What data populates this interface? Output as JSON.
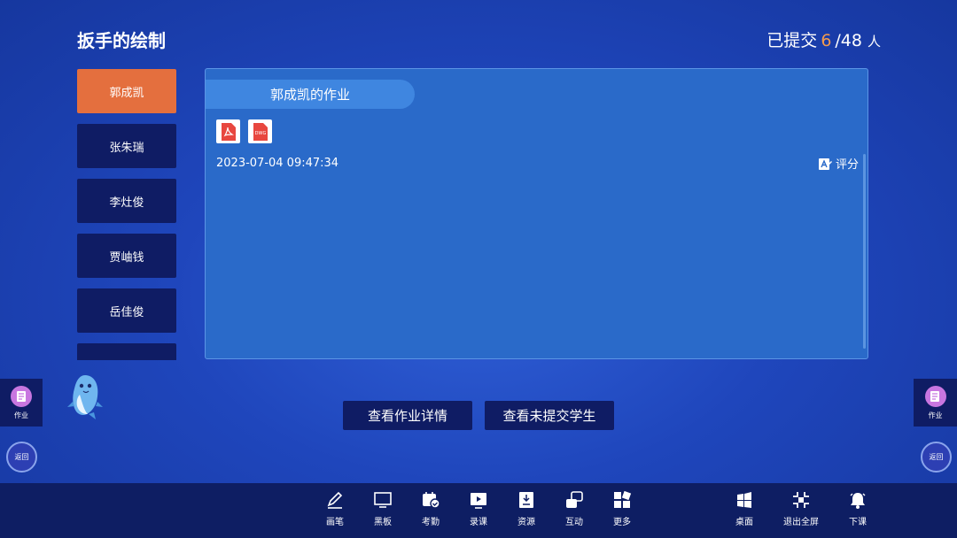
{
  "header": {
    "title": "扳手的绘制",
    "submitted_label": "已提交",
    "submitted_count": "6",
    "total": "/48",
    "unit": "人"
  },
  "students": [
    {
      "name": "郭成凯",
      "active": true
    },
    {
      "name": "张朱瑞",
      "active": false
    },
    {
      "name": "李灶俊",
      "active": false
    },
    {
      "name": "贾岫钱",
      "active": false
    },
    {
      "name": "岳佳俊",
      "active": false
    }
  ],
  "panel": {
    "tab_label": "郭成凯的作业",
    "files": [
      {
        "icon": "pdf-file-icon"
      },
      {
        "icon": "dwg-file-icon",
        "label": "DWG"
      }
    ],
    "timestamp": "2023-07-04 09:47:34",
    "grade_label": "评分"
  },
  "side": {
    "homework_label": "作业",
    "back_label": "返回"
  },
  "actions": {
    "details": "查看作业详情",
    "unsubmitted": "查看未提交学生"
  },
  "toolbar": {
    "pen": "画笔",
    "blackboard": "黑板",
    "attendance": "考勤",
    "record": "录课",
    "resources": "资源",
    "interact": "互动",
    "more": "更多",
    "desktop": "桌面",
    "exit_fullscreen": "退出全屏",
    "end_class": "下课"
  },
  "colors": {
    "accent_orange": "#e46f3e",
    "count_orange": "#f39a4e",
    "dark_navy": "#0f1c64",
    "panel_blue": "#2a6ac9"
  }
}
